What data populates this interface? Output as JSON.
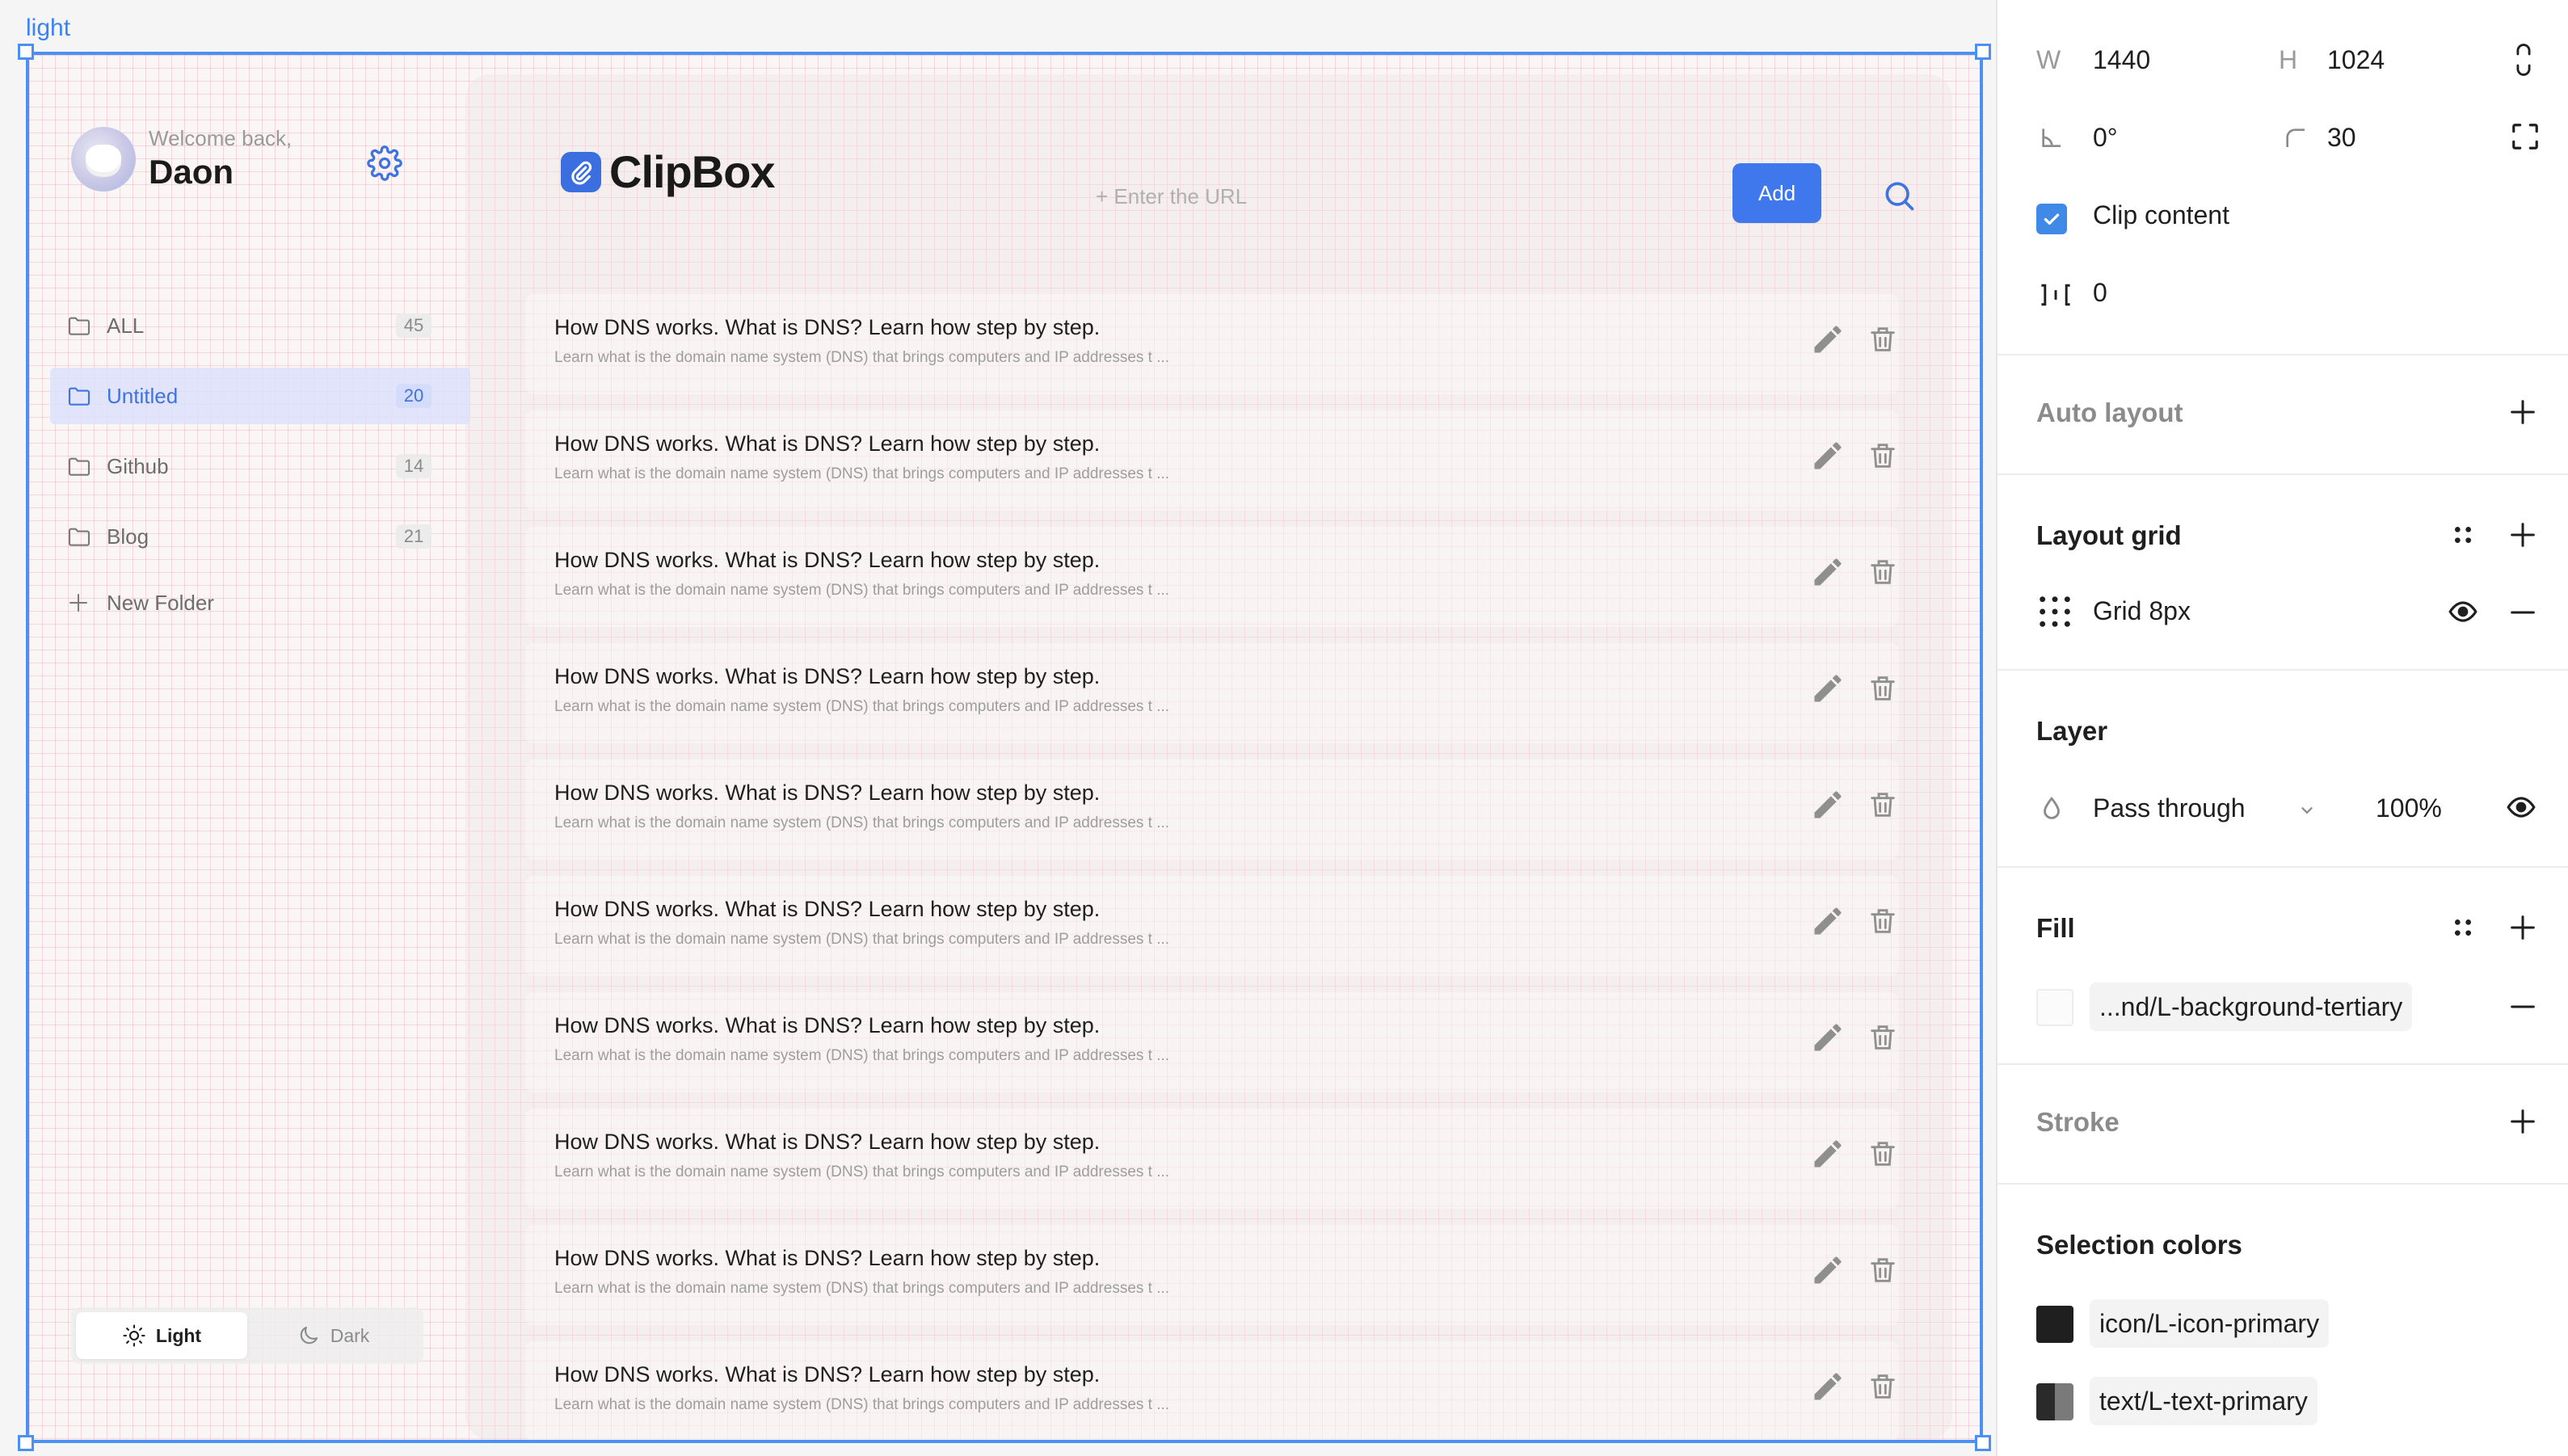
{
  "frame": {
    "label": "light"
  },
  "app": {
    "brand": "ClipBox",
    "user": {
      "welcome": "Welcome back,",
      "name": "Daon"
    },
    "url_input": {
      "placeholder": "+ Enter the URL",
      "value": ""
    },
    "add_label": "Add",
    "folders": [
      {
        "label": "ALL",
        "count": "45",
        "active": false
      },
      {
        "label": "Untitled",
        "count": "20",
        "active": true
      },
      {
        "label": "Github",
        "count": "14",
        "active": false
      },
      {
        "label": "Blog",
        "count": "21",
        "active": false
      }
    ],
    "new_folder_label": "New Folder",
    "theme": {
      "light_label": "Light",
      "dark_label": "Dark",
      "selected": "Light"
    },
    "items": [
      {
        "title": "How DNS works. What is DNS? Learn how step by step.",
        "description": "Learn what is the domain name system (DNS) that brings computers and IP addresses t ..."
      },
      {
        "title": "How DNS works. What is DNS? Learn how step by step.",
        "description": "Learn what is the domain name system (DNS) that brings computers and IP addresses t ..."
      },
      {
        "title": "How DNS works. What is DNS? Learn how step by step.",
        "description": "Learn what is the domain name system (DNS) that brings computers and IP addresses t ..."
      },
      {
        "title": "How DNS works. What is DNS? Learn how step by step.",
        "description": "Learn what is the domain name system (DNS) that brings computers and IP addresses t ..."
      },
      {
        "title": "How DNS works. What is DNS? Learn how step by step.",
        "description": "Learn what is the domain name system (DNS) that brings computers and IP addresses t ..."
      },
      {
        "title": "How DNS works. What is DNS? Learn how step by step.",
        "description": "Learn what is the domain name system (DNS) that brings computers and IP addresses t ..."
      },
      {
        "title": "How DNS works. What is DNS? Learn how step by step.",
        "description": "Learn what is the domain name system (DNS) that brings computers and IP addresses t ..."
      },
      {
        "title": "How DNS works. What is DNS? Learn how step by step.",
        "description": "Learn what is the domain name system (DNS) that brings computers and IP addresses t ..."
      },
      {
        "title": "How DNS works. What is DNS? Learn how step by step.",
        "description": "Learn what is the domain name system (DNS) that brings computers and IP addresses t ..."
      },
      {
        "title": "How DNS works. What is DNS? Learn how step by step.",
        "description": "Learn what is the domain name system (DNS) that brings computers and IP addresses t ..."
      }
    ]
  },
  "panel": {
    "w_label": "W",
    "w_value": "1440",
    "h_label": "H",
    "h_value": "1024",
    "rotation_value": "0°",
    "radius_value": "30",
    "clip_content_label": "Clip content",
    "clip_content_checked": true,
    "spacing_value": "0",
    "auto_layout_title": "Auto layout",
    "layout_grid_title": "Layout grid",
    "grid_label": "Grid 8px",
    "layer_title": "Layer",
    "blend_mode": "Pass through",
    "opacity": "100%",
    "fill_title": "Fill",
    "fill_style": "...nd/L-background-tertiary",
    "stroke_title": "Stroke",
    "selection_colors_title": "Selection colors",
    "selection_colors": [
      {
        "name": "icon/L-icon-primary",
        "color": "#1f1f1f"
      },
      {
        "name": "text/L-text-primary",
        "color": "#2a2a2a"
      }
    ]
  },
  "colors": {
    "accent": "#3f78ec",
    "selection": "#4a90f5",
    "grid": "#e29ca0"
  },
  "icons": [
    "gear-icon",
    "folder-icon",
    "plus-icon",
    "sun-icon",
    "moon-icon",
    "search-icon",
    "edit-icon",
    "trash-icon",
    "eye-icon",
    "minus-icon",
    "dots-icon",
    "drop-icon"
  ]
}
